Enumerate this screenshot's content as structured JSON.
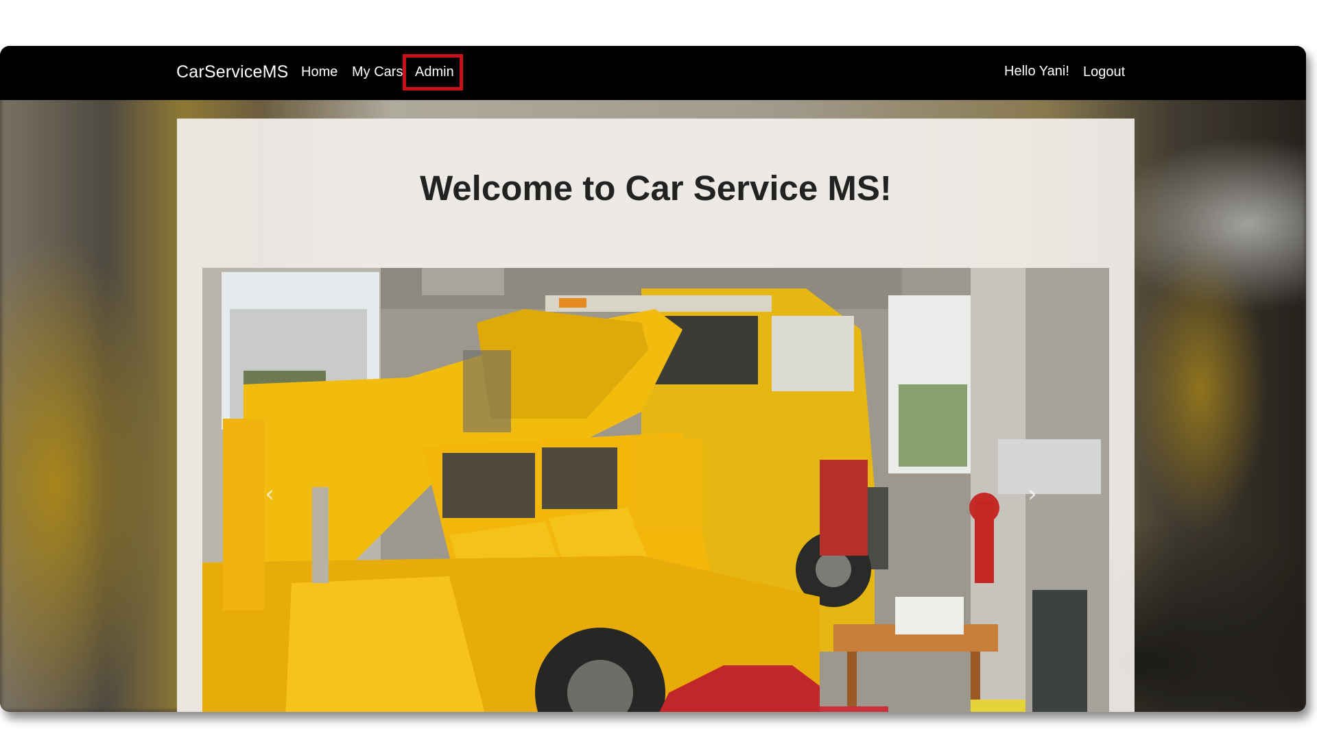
{
  "navbar": {
    "brand": "CarServiceMS",
    "links": {
      "home": "Home",
      "my_cars": "My Cars",
      "admin": "Admin"
    },
    "greeting": "Hello Yani!",
    "logout": "Logout",
    "highlight_color": "#c8111b"
  },
  "main": {
    "title": "Welcome to Car Service MS!"
  },
  "carousel": {
    "prev_icon": "chevron-left-icon",
    "next_icon": "chevron-right-icon",
    "prev_glyph": "‹",
    "next_glyph": "›"
  }
}
